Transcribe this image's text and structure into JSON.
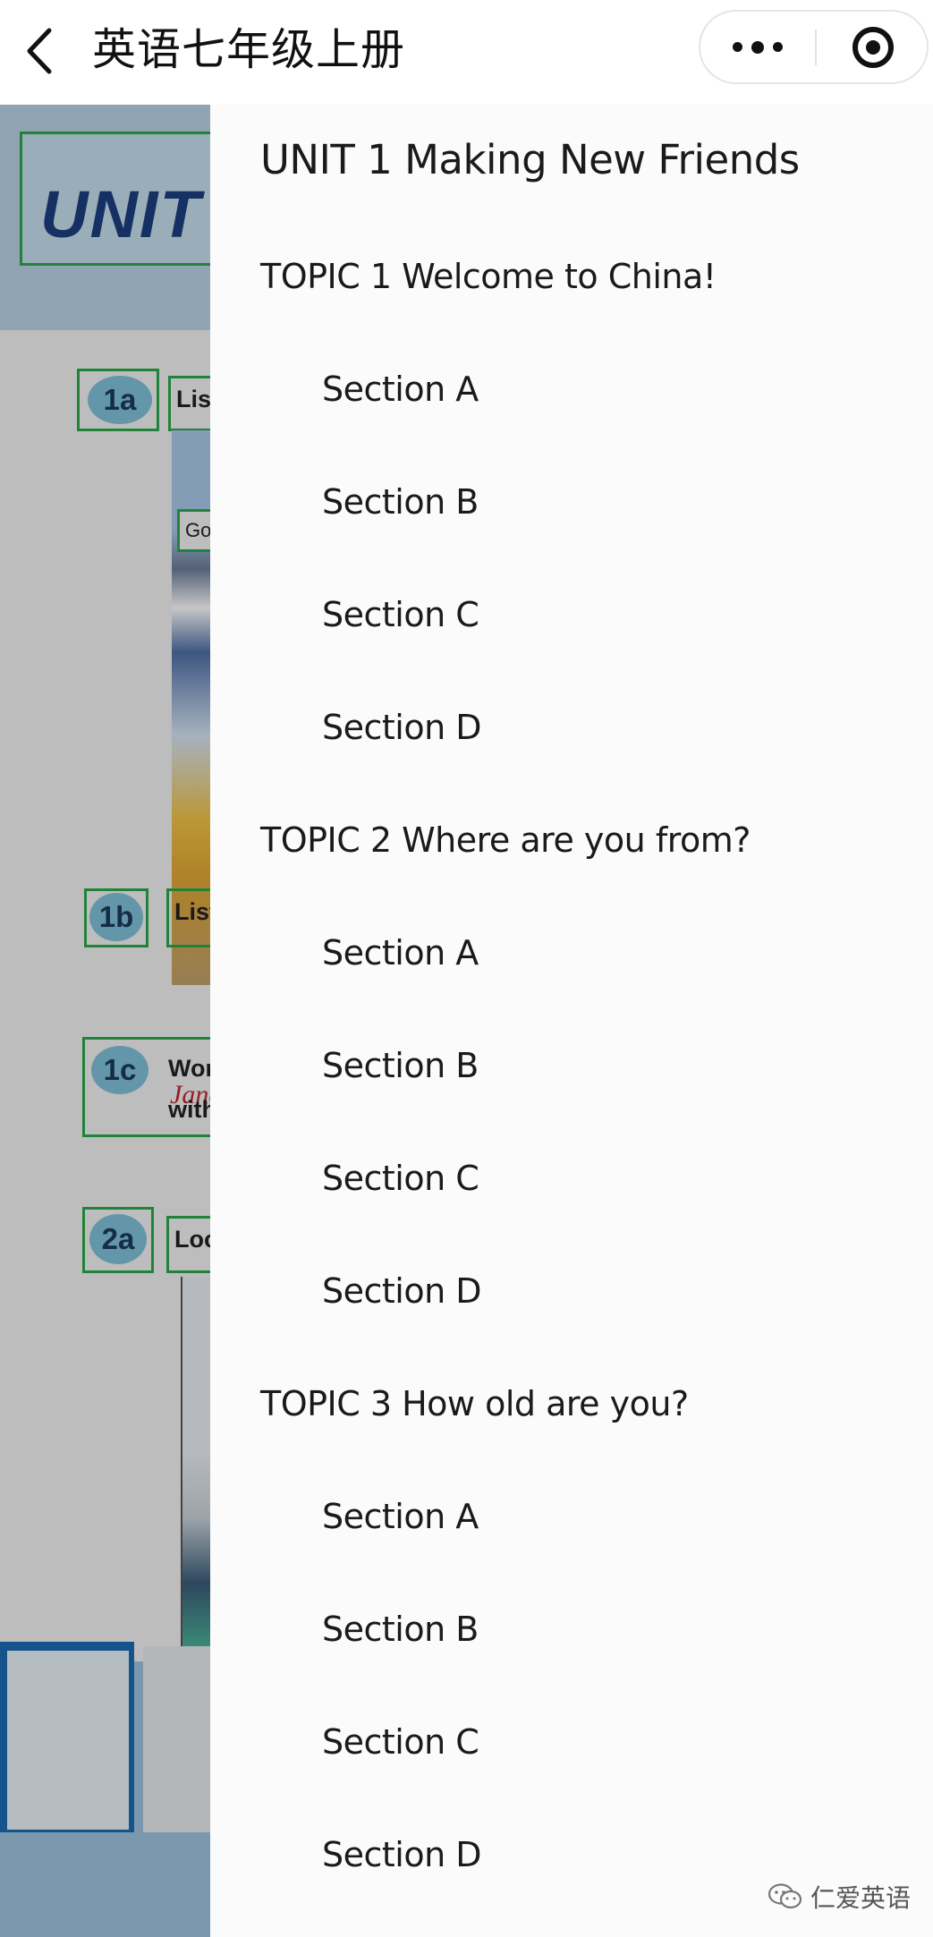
{
  "header": {
    "title": "英语七年级上册"
  },
  "background_page": {
    "unit_text": "UNIT",
    "badges": [
      "1a",
      "1b",
      "1c",
      "2a"
    ],
    "labels": [
      "Liste",
      "Go",
      "Liste",
      "Wor",
      "with",
      "Loo"
    ],
    "handwriting": "Jane"
  },
  "drawer": {
    "unit_title": "UNIT 1 Making New Friends",
    "topics": [
      {
        "title": "TOPIC 1 Welcome to China!",
        "sections": [
          "Section A",
          "Section B",
          "Section C",
          "Section D"
        ]
      },
      {
        "title": "TOPIC 2 Where are you from?",
        "sections": [
          "Section A",
          "Section B",
          "Section C",
          "Section D"
        ]
      },
      {
        "title": "TOPIC 3 How old are you?",
        "sections": [
          "Section A",
          "Section B",
          "Section C",
          "Section D"
        ]
      }
    ]
  },
  "watermark": {
    "text": "仁爱英语",
    "icon": "wechat-icon"
  },
  "colors": {
    "box_outline": "#2aa84a",
    "badge": "#7fc1d8",
    "unit_text": "#1c3f80"
  }
}
